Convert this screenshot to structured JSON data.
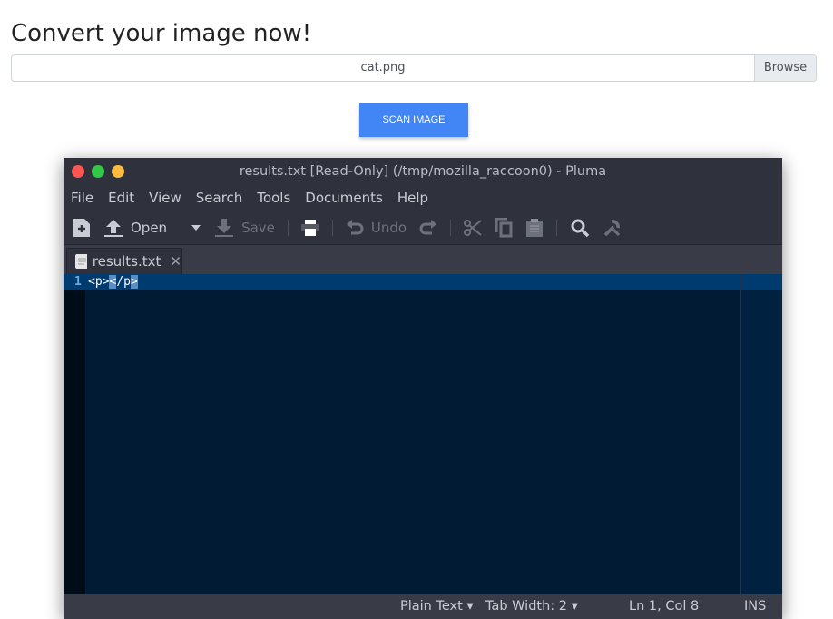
{
  "page": {
    "heading": "Convert your image now!",
    "file_name": "cat.png",
    "browse_label": "Browse",
    "scan_label": "SCAN IMAGE"
  },
  "window": {
    "title": "results.txt [Read-Only] (/tmp/mozilla_raccoon0) - Pluma",
    "menu": [
      "File",
      "Edit",
      "View",
      "Search",
      "Tools",
      "Documents",
      "Help"
    ],
    "toolbar": {
      "open": "Open",
      "save": "Save",
      "undo": "Undo"
    },
    "tab": {
      "label": "results.txt"
    },
    "editor": {
      "line_number": "1",
      "code_a": "<p>",
      "code_b": "<",
      "code_c": "/p",
      "code_d": ">"
    },
    "status": {
      "language": "Plain Text",
      "tab_width": "Tab Width:  2",
      "position": "Ln 1, Col 8",
      "mode": "INS"
    },
    "colors": {
      "close": "#fc5753",
      "minimize": "#33c748",
      "maximize": "#fdbc40",
      "accent": "#4285f4"
    }
  }
}
